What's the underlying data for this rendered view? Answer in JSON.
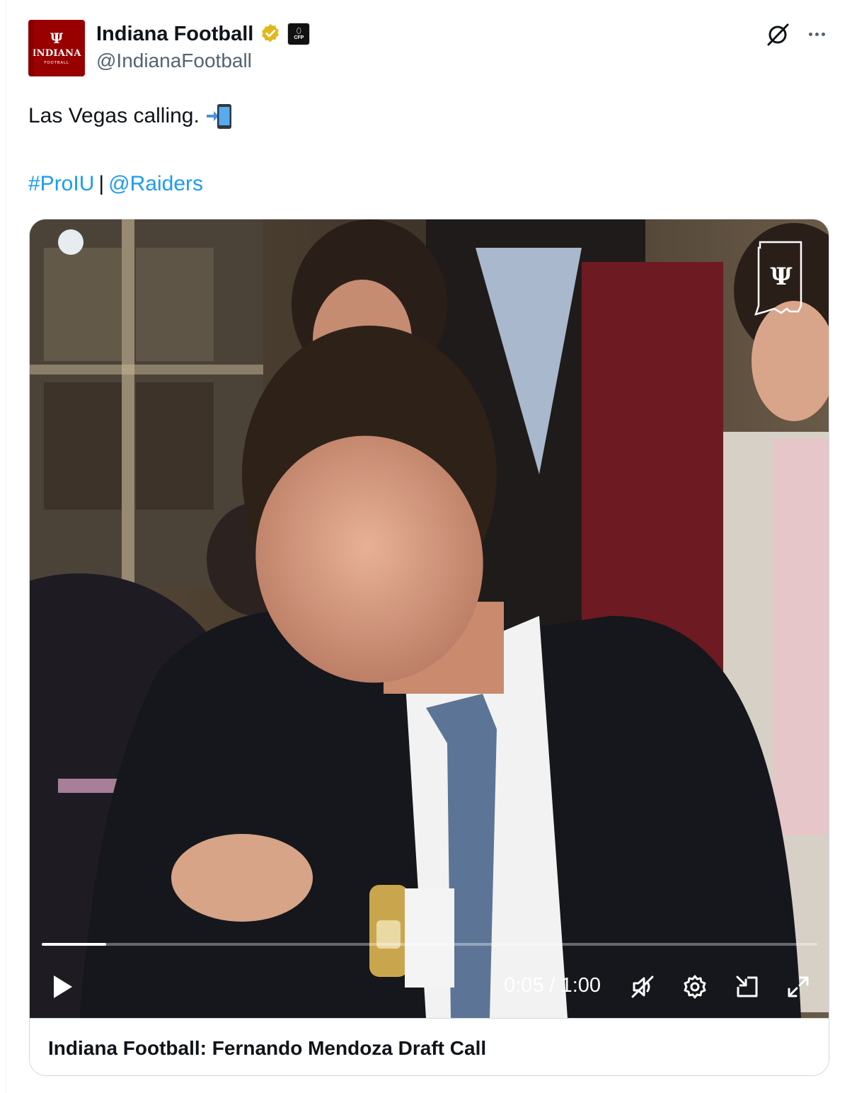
{
  "author": {
    "display_name": "Indiana Football",
    "handle": "@IndianaFootball",
    "avatar_text": "INDIANA",
    "avatar_subtext": "FOOTBALL",
    "affiliate_badge_text": "CFP",
    "verified_color": "#e2b719"
  },
  "tweet": {
    "text": "Las Vegas calling.",
    "emoji_icon": "phone-with-arrow-icon",
    "hashtag": "#ProIU",
    "separator": "|",
    "mention": "@Raiders"
  },
  "video": {
    "current_time": "0:05",
    "duration": "1:00",
    "time_display": "0:05 / 1:00",
    "progress_fraction": 0.083,
    "muted": true,
    "controls": [
      "play-icon",
      "mute-icon",
      "settings-icon",
      "pip-icon",
      "fullscreen-icon"
    ]
  },
  "card": {
    "title": "Indiana Football: Fernando Mendoza Draft Call"
  },
  "colors": {
    "link": "#1d9bf0",
    "brand": "#990000",
    "secondary_text": "#536471"
  }
}
